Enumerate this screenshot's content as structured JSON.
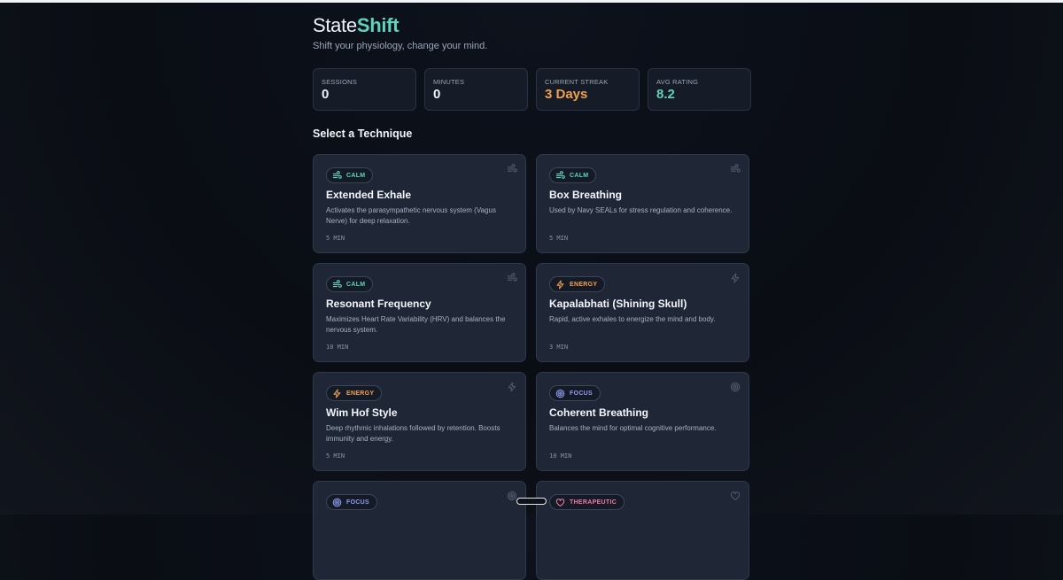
{
  "brand": {
    "part1": "State",
    "part2": "Shift",
    "tagline": "Shift your physiology, change your mind."
  },
  "stats": [
    {
      "label": "SESSIONS",
      "value": "0",
      "color": "#eef2f8"
    },
    {
      "label": "MINUTES",
      "value": "0",
      "color": "#eef2f8"
    },
    {
      "label": "CURRENT STREAK",
      "value": "3 Days",
      "color": "#f0a050"
    },
    {
      "label": "AVG RATING",
      "value": "8.2",
      "color": "#5fd1bd"
    }
  ],
  "section_title": "Select a Technique",
  "categories": {
    "calm": {
      "label": "CALM",
      "color": "#5fd1bd",
      "icon": "wind-icon"
    },
    "energy": {
      "label": "ENERGY",
      "color": "#f0a050",
      "icon": "lightning-icon"
    },
    "focus": {
      "label": "FOCUS",
      "color": "#8f9cf0",
      "icon": "target-icon"
    },
    "therapeutic": {
      "label": "THERAPEUTIC",
      "color": "#f07aa8",
      "icon": "heart-icon"
    }
  },
  "techniques": [
    {
      "category": "CALM",
      "title": "Extended Exhale",
      "description": "Activates the parasympathetic nervous system (Vagus Nerve) for deep relaxation.",
      "duration": "5 MIN"
    },
    {
      "category": "CALM",
      "title": "Box Breathing",
      "description": "Used by Navy SEALs for stress regulation and coherence.",
      "duration": "5 MIN"
    },
    {
      "category": "CALM",
      "title": "Resonant Frequency",
      "description": "Maximizes Heart Rate Variability (HRV) and balances the nervous system.",
      "duration": "10 MIN"
    },
    {
      "category": "ENERGY",
      "title": "Kapalabhati (Shining Skull)",
      "description": "Rapid, active exhales to energize the mind and body.",
      "duration": "3 MIN"
    },
    {
      "category": "ENERGY",
      "title": "Wim Hof Style",
      "description": "Deep rhythmic inhalations followed by retention. Boosts immunity and energy.",
      "duration": "5 MIN"
    },
    {
      "category": "FOCUS",
      "title": "Coherent Breathing",
      "description": "Balances the mind for optimal cognitive performance.",
      "duration": "10 MIN"
    },
    {
      "category": "FOCUS"
    },
    {
      "category": "THERAPEUTIC"
    }
  ]
}
